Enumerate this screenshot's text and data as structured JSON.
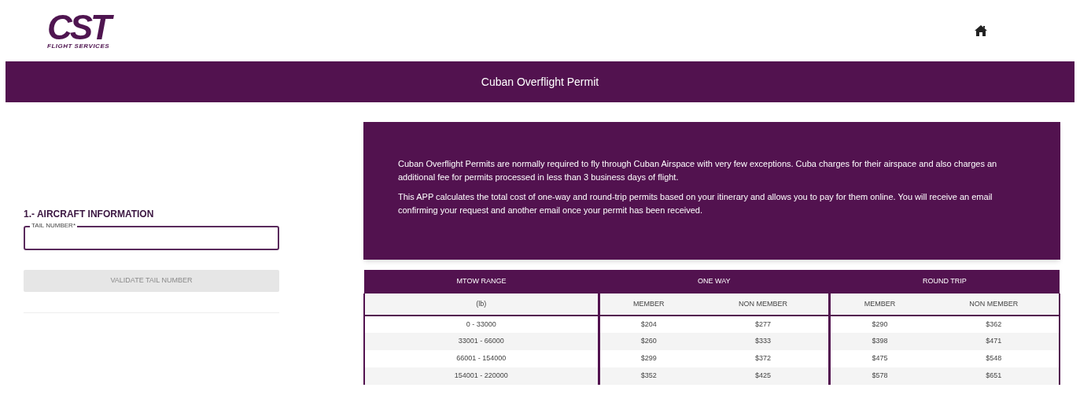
{
  "logo": {
    "mark": "CST",
    "subtitle": "FLIGHT SERVICES"
  },
  "title_bar": {
    "title": "Cuban Overflight Permit"
  },
  "aircraft_section": {
    "heading": "1.- AIRCRAFT INFORMATION",
    "tail_number_field": {
      "label": "TAIL NUMBER*"
    },
    "validate_button": {
      "label": "VALIDATE TAIL NUMBER",
      "disabled": true
    }
  },
  "info_card": {
    "paragraphs": [
      "Cuban Overflight Permits are normally required to fly through Cuban Airspace with very few exceptions. Cuba charges for their airspace and also charges an additional fee for permits processed in less than 3 business days of flight.",
      "This APP calculates the total cost of one-way and round-trip permits based on your itinerary and allows you to pay for them online. You will receive an email confirming your request and another email once your permit has been received."
    ]
  },
  "fee_table": {
    "groups": [
      "MTOW RANGE",
      "ONE WAY",
      "ROUND TRIP"
    ],
    "columns": [
      "(lb)",
      "MEMBER",
      "NON MEMBER",
      "MEMBER",
      "NON MEMBER"
    ],
    "rows": [
      [
        "0 - 33000",
        "$204",
        "$277",
        "$290",
        "$362"
      ],
      [
        "33001 - 66000",
        "$260",
        "$333",
        "$398",
        "$471"
      ],
      [
        "66001 - 154000",
        "$299",
        "$372",
        "$475",
        "$548"
      ],
      [
        "154001 - 220000",
        "$352",
        "$425",
        "$578",
        "$651"
      ]
    ]
  }
}
